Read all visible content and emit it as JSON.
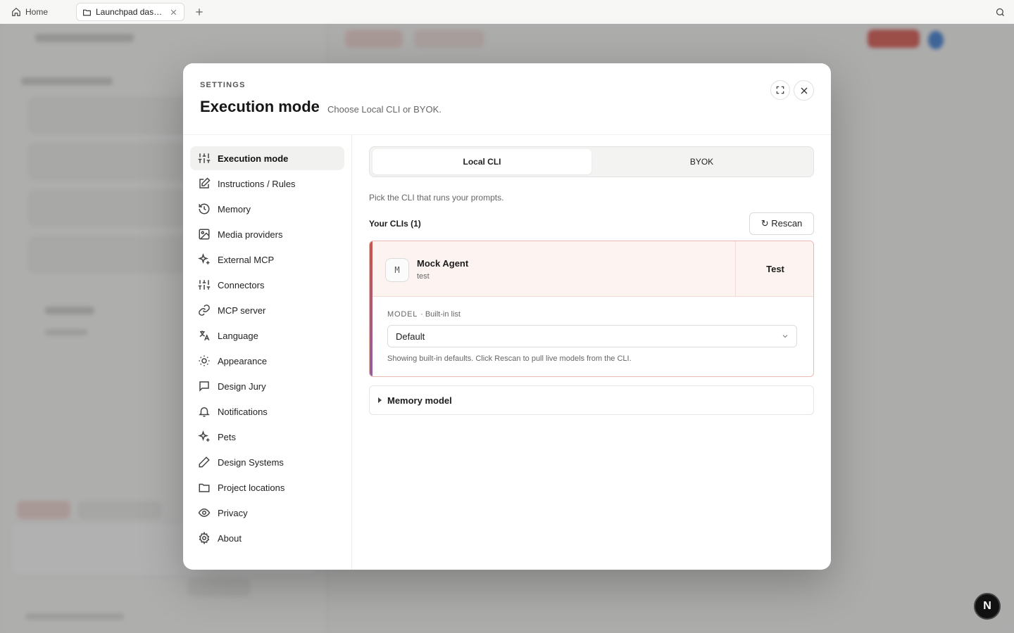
{
  "topbar": {
    "home_label": "Home",
    "active_tab": "Launchpad dash…",
    "icons": [
      "home-icon",
      "folder-icon",
      "close-icon",
      "plus-icon",
      "search-icon"
    ]
  },
  "modal": {
    "kicker": "SETTINGS",
    "title": "Execution mode",
    "subtitle": "Choose Local CLI or BYOK.",
    "nav": [
      {
        "label": "Execution mode",
        "icon": "sliders-icon",
        "active": true
      },
      {
        "label": "Instructions / Rules",
        "icon": "edit-icon"
      },
      {
        "label": "Memory",
        "icon": "history-icon"
      },
      {
        "label": "Media providers",
        "icon": "image-icon"
      },
      {
        "label": "External MCP",
        "icon": "sparkle-icon"
      },
      {
        "label": "Connectors",
        "icon": "sliders-icon"
      },
      {
        "label": "MCP server",
        "icon": "link-icon"
      },
      {
        "label": "Language",
        "icon": "translate-icon"
      },
      {
        "label": "Appearance",
        "icon": "sun-icon"
      },
      {
        "label": "Design Jury",
        "icon": "chat-icon"
      },
      {
        "label": "Notifications",
        "icon": "bell-icon"
      },
      {
        "label": "Pets",
        "icon": "sparkle-icon"
      },
      {
        "label": "Design Systems",
        "icon": "pencil-icon"
      },
      {
        "label": "Project locations",
        "icon": "folder-icon"
      },
      {
        "label": "Privacy",
        "icon": "eye-icon"
      },
      {
        "label": "About",
        "icon": "gear-icon"
      }
    ],
    "segments": {
      "local": "Local CLI",
      "byok": "BYOK",
      "selected": "Local CLI"
    },
    "help_text": "Pick the CLI that runs your prompts.",
    "clis_heading": "Your CLIs (1)",
    "rescan_label": "↻ Rescan",
    "cli": {
      "avatar": "M",
      "name": "Mock Agent",
      "sub": "test",
      "test_label": "Test",
      "model_label": "MODEL",
      "model_source": "· Built-in list",
      "model_value": "Default",
      "model_note": "Showing built-in defaults. Click Rescan to pull live models from the CLI."
    },
    "memory_model_label": "Memory model",
    "accent_color": "#c8564a"
  },
  "fab_label": "N"
}
